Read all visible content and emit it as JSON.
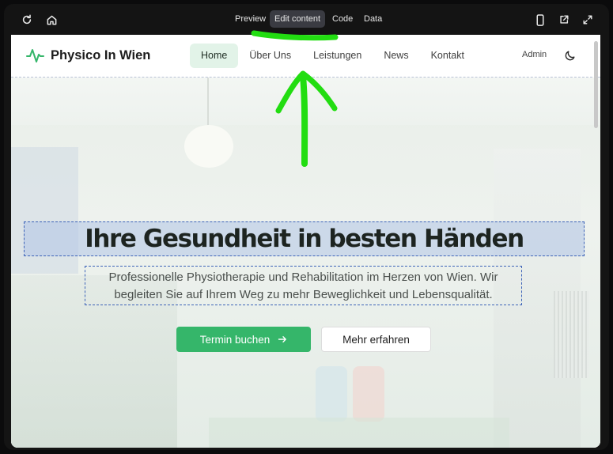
{
  "toolbar": {
    "tabs": [
      "Preview",
      "Edit content",
      "Code",
      "Data"
    ],
    "active_tab": "Edit content"
  },
  "site": {
    "logo_text": "Physico In Wien",
    "nav": [
      "Home",
      "Über Uns",
      "Leistungen",
      "News",
      "Kontakt"
    ],
    "active_nav": "Home",
    "admin_label": "Admin"
  },
  "hero": {
    "headline": "Ihre Gesundheit in besten Händen",
    "subtitle_line1": "Professionelle Physiotherapie und Rehabilitation im Herzen von Wien. Wir",
    "subtitle_line2": "begleiten Sie auf Ihrem Weg zu mehr Beweglichkeit und Lebensqualität.",
    "primary_button": "Termin buchen",
    "secondary_button": "Mehr erfahren"
  },
  "colors": {
    "accent_green": "#35b66a",
    "annotation_green": "#22dd11",
    "selection_blue": "#3d63b8"
  },
  "icons": [
    "refresh-icon",
    "home-icon",
    "mobile-icon",
    "external-link-icon",
    "expand-icon",
    "pulse-logo-icon",
    "moon-icon",
    "arrow-right-icon"
  ]
}
